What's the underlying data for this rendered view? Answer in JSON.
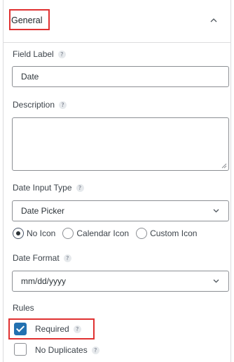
{
  "section": {
    "title": "General"
  },
  "field_label": {
    "label": "Field Label",
    "help": "?",
    "value": "Date"
  },
  "description": {
    "label": "Description",
    "help": "?",
    "value": ""
  },
  "date_input_type": {
    "label": "Date Input Type",
    "help": "?",
    "selected": "Date Picker",
    "icon_options": [
      {
        "label": "No Icon",
        "checked": true
      },
      {
        "label": "Calendar Icon",
        "checked": false
      },
      {
        "label": "Custom Icon",
        "checked": false
      }
    ]
  },
  "date_format": {
    "label": "Date Format",
    "help": "?",
    "selected": "mm/dd/yyyy"
  },
  "rules": {
    "label": "Rules",
    "required": {
      "label": "Required",
      "help": "?",
      "checked": true
    },
    "no_duplicates": {
      "label": "No Duplicates",
      "help": "?",
      "checked": false
    }
  },
  "colors": {
    "accent": "#2271b1",
    "highlight": "#e03131"
  },
  "icons": {
    "collapse": "chevron-up-icon",
    "dropdown": "chevron-down-icon",
    "help": "question-icon"
  }
}
